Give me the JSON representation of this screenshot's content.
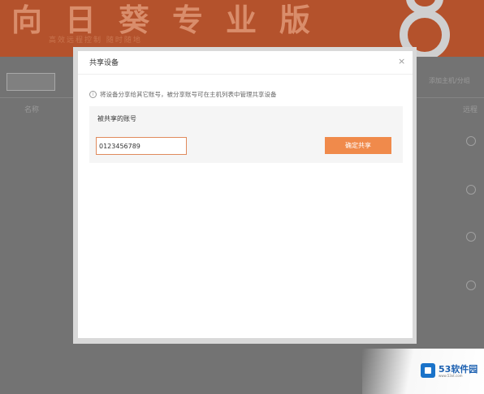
{
  "background_app": {
    "brand_title": "向日葵专业版",
    "brand_subtitle": "高效远程控制 随时随地",
    "search_placeholder": "",
    "left_column_label": "名称",
    "top_right_text": "添加主机/分组",
    "right_column_label": "远程"
  },
  "share_dialog": {
    "title": "共享设备",
    "close_glyph": "×",
    "notice_icon": "info-circle-icon",
    "notice_text": "将设备分享给其它账号，被分享账号可在主机列表中管理共享设备",
    "account_label": "被共享的账号",
    "account_value": "0123456789",
    "confirm_label": "确定共享"
  },
  "watermark": {
    "site_name": "53软件园",
    "site_url": "www.53xt.com"
  },
  "colors": {
    "accent": "#f08a4b",
    "banner": "#b4522c",
    "input_border": "#e08a5c",
    "watermark_blue": "#1a73c9"
  }
}
